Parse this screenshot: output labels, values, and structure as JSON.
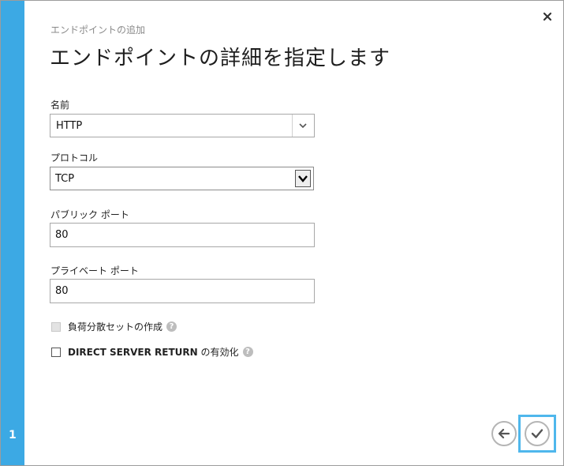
{
  "wizard": {
    "step_number": "1",
    "subtitle": "エンドポイントの追加",
    "title": "エンドポイントの詳細を指定します"
  },
  "form": {
    "name_label": "名前",
    "name_value": "HTTP",
    "protocol_label": "プロトコル",
    "protocol_value": "TCP",
    "public_port_label": "パブリック ポート",
    "public_port_value": "80",
    "private_port_label": "プライベート ポート",
    "private_port_value": "80",
    "load_balance_label": "負荷分散セットの作成",
    "direct_server_return_prefix": "DIRECT SERVER RETURN",
    "direct_server_return_suffix": " の有効化"
  },
  "icons": {
    "close": "close-icon",
    "dropdown": "chevron-down-icon",
    "help": "help-icon",
    "back": "arrow-left-icon",
    "complete": "checkmark-icon"
  },
  "colors": {
    "accent": "#3ca9e4",
    "focus_border": "#4fb7ec"
  }
}
